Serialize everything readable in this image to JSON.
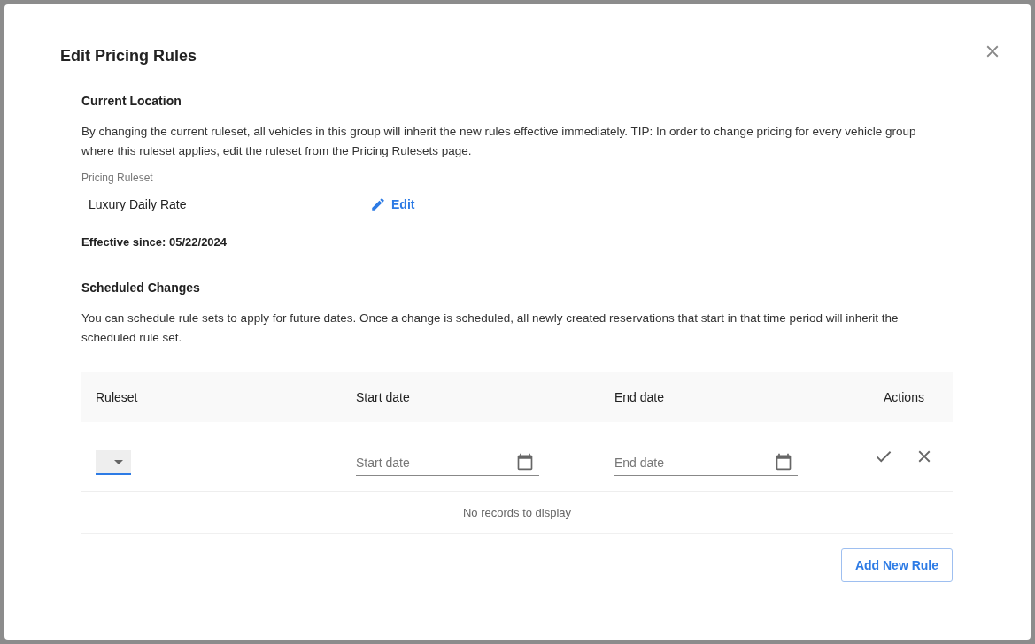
{
  "dialog": {
    "title": "Edit Pricing Rules"
  },
  "current_location": {
    "heading": "Current Location",
    "description": "By changing the current ruleset, all vehicles in this group will inherit the new rules effective immediately. TIP: In order to change pricing for every vehicle group where this ruleset applies, edit the ruleset from the Pricing Rulesets page.",
    "field_label": "Pricing Ruleset",
    "ruleset": "Luxury Daily Rate",
    "edit_link": "Edit",
    "effective_since": "Effective since: 05/22/2024"
  },
  "scheduled_changes": {
    "heading": "Scheduled Changes",
    "description": "You can schedule rule sets to apply for future dates. Once a change is scheduled, all newly created reservations that start in that time period will inherit the scheduled rule set."
  },
  "table": {
    "columns": [
      "Ruleset",
      "Start date",
      "End date",
      "Actions"
    ],
    "new_row": {
      "start_placeholder": "Start date",
      "end_placeholder": "End date"
    },
    "empty_message": "No records to display"
  },
  "add_button": "Add New Rule"
}
